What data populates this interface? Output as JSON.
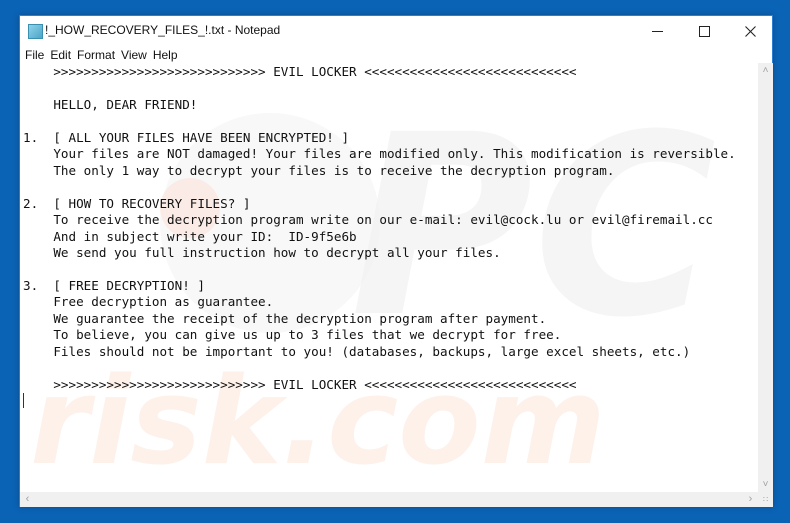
{
  "window": {
    "title": "!_HOW_RECOVERY_FILES_!.txt - Notepad",
    "controls": {
      "minimize": "minimize",
      "maximize": "maximize",
      "close": "close"
    }
  },
  "menu": {
    "items": [
      "File",
      "Edit",
      "Format",
      "View",
      "Help"
    ]
  },
  "document": {
    "lines": [
      "    >>>>>>>>>>>>>>>>>>>>>>>>>>>> EVIL LOCKER <<<<<<<<<<<<<<<<<<<<<<<<<<<<",
      "",
      "    HELLO, DEAR FRIEND!",
      "",
      "1.  [ ALL YOUR FILES HAVE BEEN ENCRYPTED! ]",
      "    Your files are NOT damaged! Your files are modified only. This modification is reversible.",
      "    The only 1 way to decrypt your files is to receive the decryption program.",
      "",
      "2.  [ HOW TO RECOVERY FILES? ]",
      "    To receive the decryption program write on our e-mail: evil@cock.lu or evil@firemail.cc",
      "    And in subject write your ID:  ID-9f5e6b",
      "    We send you full instruction how to decrypt all your files.",
      "",
      "3.  [ FREE DECRYPTION! ]",
      "    Free decryption as guarantee.",
      "    We guarantee the receipt of the decryption program after payment.",
      "    To believe, you can give us up to 3 files that we decrypt for free.",
      "    Files should not be important to you! (databases, backups, large excel sheets, etc.)",
      "",
      "    >>>>>>>>>>>>>>>>>>>>>>>>>>>> EVIL LOCKER <<<<<<<<<<<<<<<<<<<<<<<<<<<<"
    ]
  },
  "watermark": {
    "text_top": "PC",
    "text_bottom": "risk.com"
  },
  "icons": {
    "app": "notepad-icon",
    "scroll_up": "˄",
    "scroll_down": "˅",
    "scroll_left": "‹",
    "scroll_right": "›",
    "grip": "∷"
  },
  "colors": {
    "desktop": "#0b63b6",
    "window": "#ffffff",
    "text": "#111111"
  }
}
